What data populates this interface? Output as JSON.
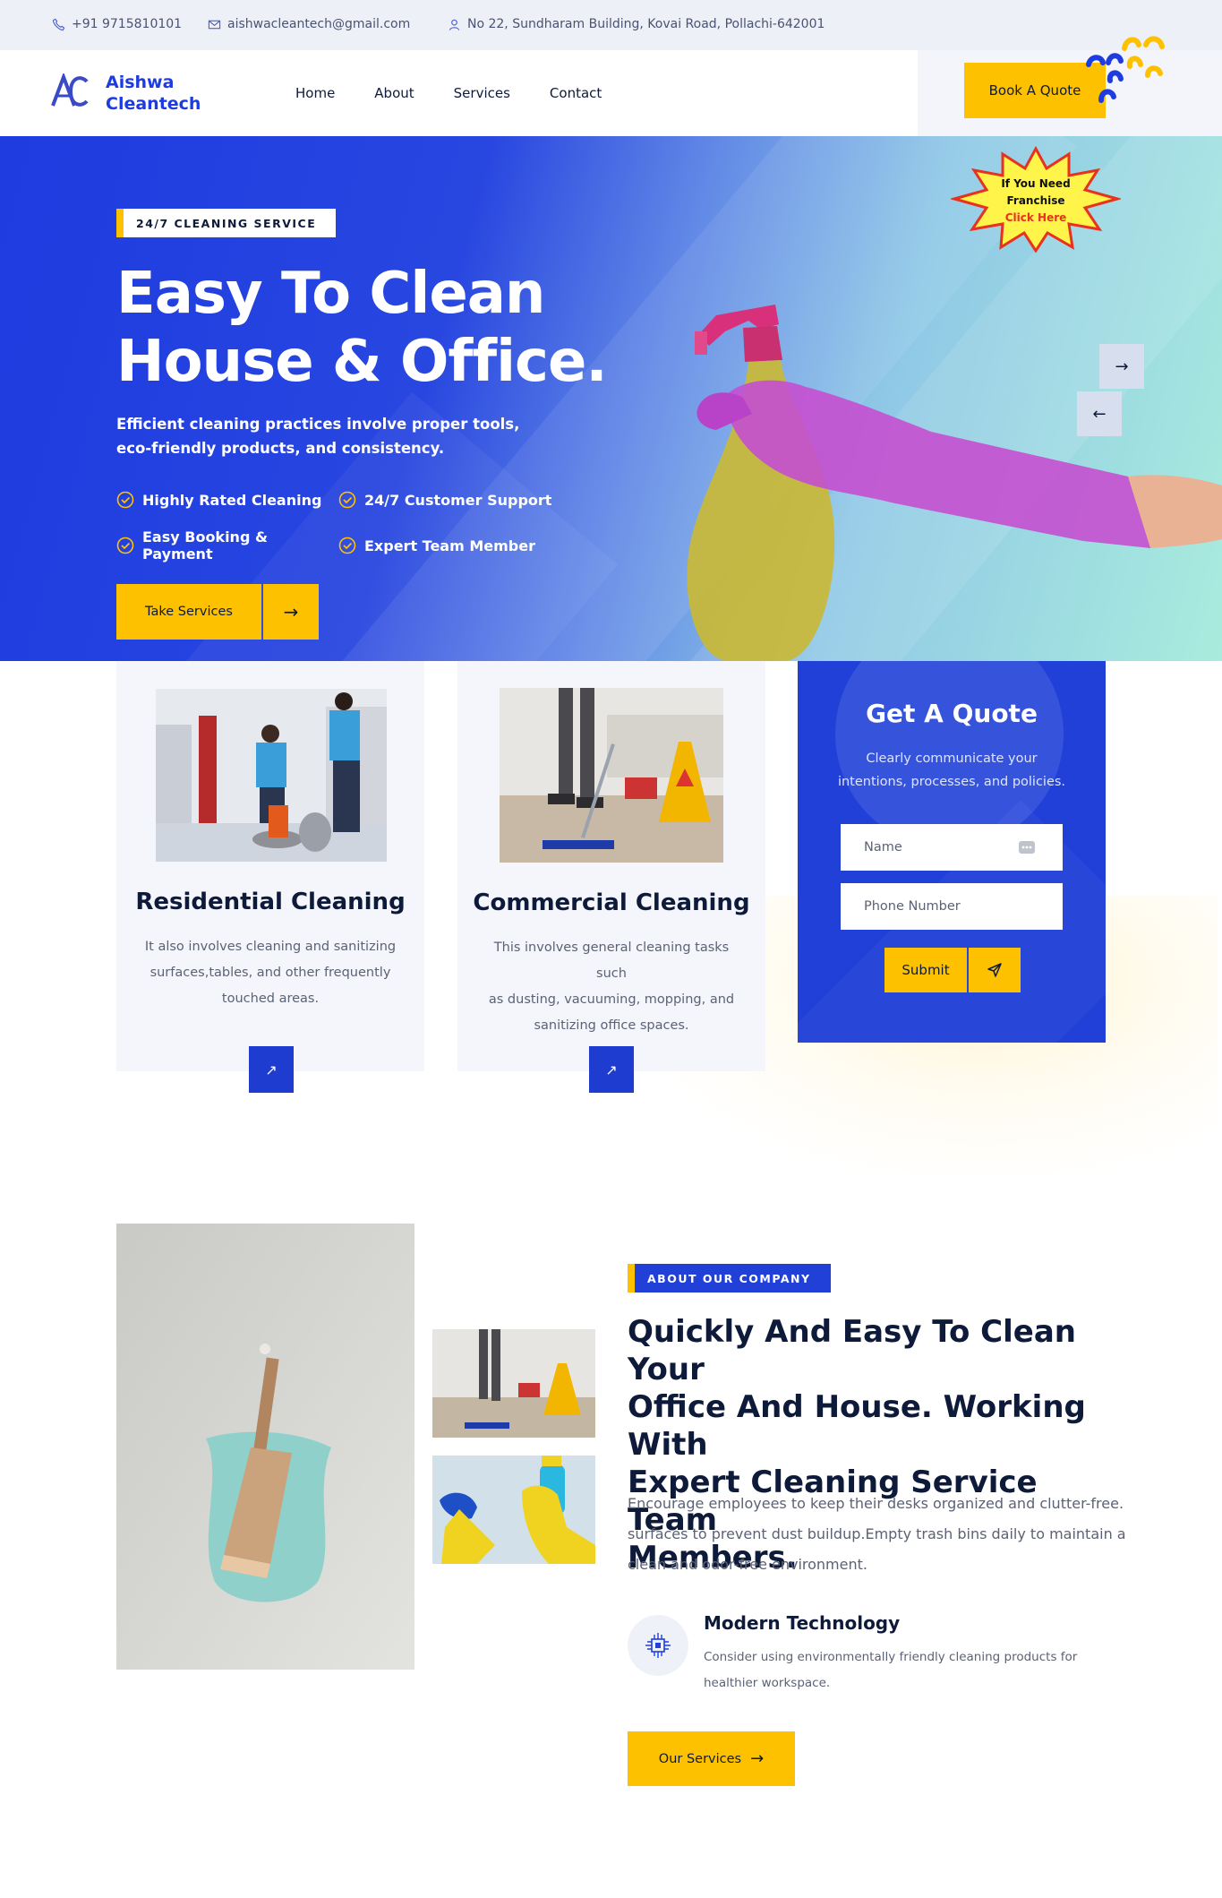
{
  "topbar": {
    "phone": "+91 9715810101",
    "email": "aishwacleantech@gmail.com",
    "address": "No 22, Sundharam Building, Kovai Road, Pollachi-642001",
    "phone_icon": "phone-icon",
    "email_icon": "envelope-icon",
    "address_icon": "user-location-icon"
  },
  "header": {
    "logo_line1": "Aishwa",
    "logo_line2": "Cleantech",
    "nav": [
      "Home",
      "About",
      "Services",
      "Contact"
    ],
    "cta": "Book A Quote"
  },
  "hero": {
    "tag": "24/7 CLEANING SERVICE",
    "title_line1": "Easy To Clean",
    "title_line2": "House & Office.",
    "lead_line1": "Efficient cleaning practices involve proper tools,",
    "lead_line2": "eco-friendly products, and consistency.",
    "features": [
      "Highly Rated Cleaning",
      "24/7 Customer Support",
      "Easy Booking & Payment",
      "Expert Team Member"
    ],
    "button": "Take Services",
    "franchise_line1": "If You Need",
    "franchise_line2": "Franchise",
    "franchise_line3": "Click Here"
  },
  "services": [
    {
      "title": "Residential Cleaning",
      "desc_line1": "It also involves cleaning and sanitizing",
      "desc_line2": "surfaces,tables, and other frequently",
      "desc_line3": "touched areas."
    },
    {
      "title": "Commercial Cleaning",
      "desc_line1": "This involves general cleaning tasks such",
      "desc_line2": "as dusting, vacuuming, mopping, and",
      "desc_line3": "sanitizing office spaces."
    }
  ],
  "quote": {
    "title": "Get A Quote",
    "desc_line1": "Clearly communicate your",
    "desc_line2": "intentions, processes, and policies.",
    "name_placeholder": "Name",
    "phone_placeholder": "Phone Number",
    "submit": "Submit"
  },
  "about": {
    "tag": "ABOUT OUR COMPANY",
    "heading_line1": "Quickly And Easy To Clean Your",
    "heading_line2": "Office And House. Working With",
    "heading_line3": "Expert Cleaning Service Team",
    "heading_line4": "Members.",
    "para_line1": "Encourage employees to keep their desks organized and clutter-free.",
    "para_line2": "surfaces to prevent dust buildup.Empty trash bins daily to maintain a",
    "para_line3": "clean and odor-free environment.",
    "tech_title": "Modern Technology",
    "tech_desc_line1": "Consider using environmentally friendly cleaning products for",
    "tech_desc_line2": "healthier workspace.",
    "button": "Our Services"
  },
  "colors": {
    "primary": "#1e3ce0",
    "accent": "#fdc100",
    "dark": "#0e1a3a"
  }
}
